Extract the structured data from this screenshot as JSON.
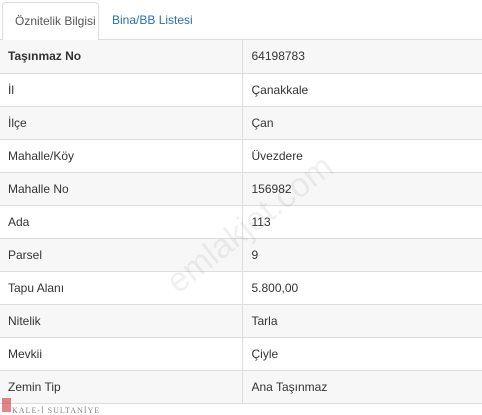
{
  "tabs": [
    {
      "label": "Öznitelik Bilgisi",
      "active": true
    },
    {
      "label": "Bina/BB Listesi",
      "active": false
    }
  ],
  "rows": [
    {
      "label": "Taşınmaz No",
      "value": "64198783"
    },
    {
      "label": "İl",
      "value": "Çanakkale"
    },
    {
      "label": "İlçe",
      "value": "Çan"
    },
    {
      "label": "Mahalle/Köy",
      "value": "Üvezdere"
    },
    {
      "label": "Mahalle No",
      "value": "156982"
    },
    {
      "label": "Ada",
      "value": "113"
    },
    {
      "label": "Parsel",
      "value": "9"
    },
    {
      "label": "Tapu Alanı",
      "value": "5.800,00"
    },
    {
      "label": "Nitelik",
      "value": "Tarla"
    },
    {
      "label": "Mevkii",
      "value": "Çiyle"
    },
    {
      "label": "Zemin Tip",
      "value": "Ana Taşınmaz"
    }
  ],
  "watermark": "emlakjet.com",
  "logo_text": "KALE-İ SULTANİYE",
  "colors": {
    "link": "#2a6fb4",
    "border": "#dddddd",
    "stripe": "#f7f7f7"
  }
}
